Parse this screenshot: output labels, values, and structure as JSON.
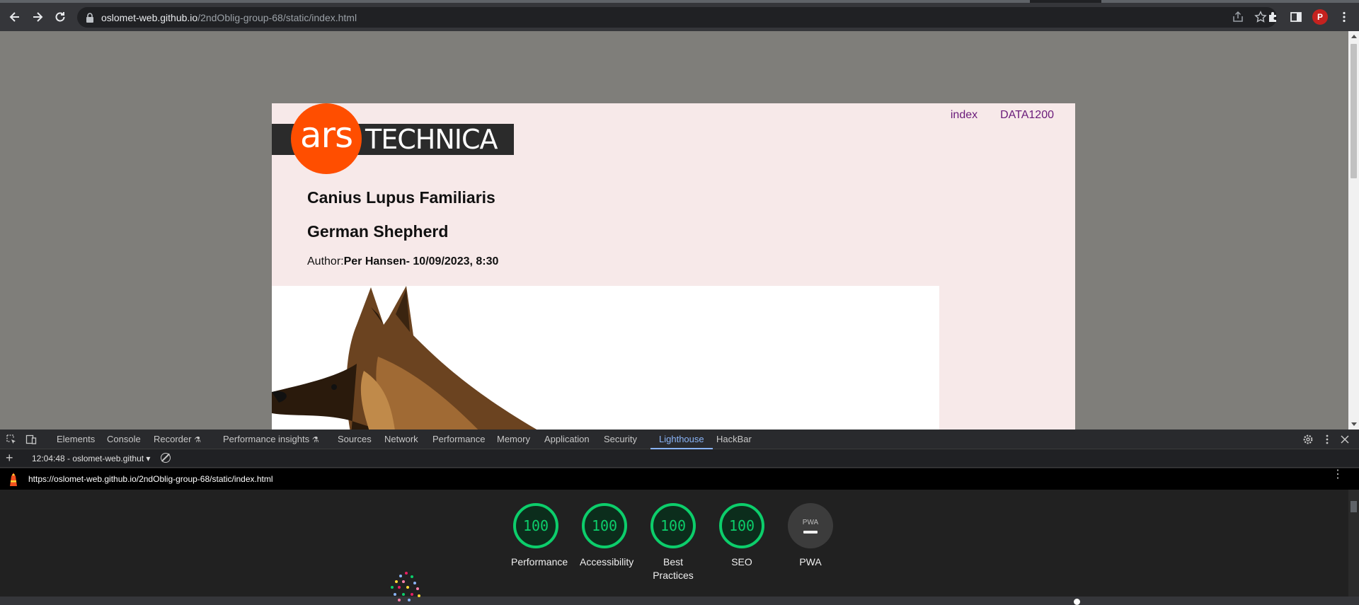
{
  "browser": {
    "url_host": "oslomet-web.github.io",
    "url_path": "/2ndOblig-group-68/static/index.html",
    "avatar_letter": "P"
  },
  "page": {
    "logo": {
      "ars": "ars",
      "technica": "TECHNICA"
    },
    "nav": {
      "index": "index",
      "data1200": "DATA1200"
    },
    "heading1": "Canius Lupus Familiaris",
    "heading2": "German Shepherd",
    "author_label": "Author:",
    "author_value": "Per Hansen- 10/09/2023, 8:30"
  },
  "devtools": {
    "tabs": [
      {
        "label": "Elements"
      },
      {
        "label": "Console"
      },
      {
        "label": "Recorder"
      },
      {
        "label": "Performance insights"
      },
      {
        "label": "Sources"
      },
      {
        "label": "Network"
      },
      {
        "label": "Performance"
      },
      {
        "label": "Memory"
      },
      {
        "label": "Application"
      },
      {
        "label": "Security"
      },
      {
        "label": "Lighthouse"
      },
      {
        "label": "HackBar"
      }
    ],
    "report_selector": "12:04:48 - oslomet-web.githut",
    "report_url": "https://oslomet-web.github.io/2ndOblig-group-68/static/index.html",
    "scores": [
      {
        "label": "Performance",
        "value": "100"
      },
      {
        "label": "Accessibility",
        "value": "100"
      },
      {
        "label": "Best\nPractices",
        "value": "100"
      },
      {
        "label": "SEO",
        "value": "100"
      }
    ],
    "pwa": {
      "label": "PWA",
      "badge": "PWA"
    }
  },
  "colors": {
    "score_good": "#0cce6b",
    "logo_orange": "#ff4e00",
    "nav_link": "#6a1b7a",
    "active_tab": "#8ab4f8"
  },
  "icons": [
    "back-arrow-icon",
    "forward-arrow-icon",
    "reload-icon",
    "lock-icon",
    "share-icon",
    "star-icon",
    "extensions-icon",
    "side-panel-icon",
    "kebab-menu-icon",
    "inspect-icon",
    "device-toolbar-icon",
    "settings-icon",
    "close-icon",
    "lighthouse-icon"
  ]
}
